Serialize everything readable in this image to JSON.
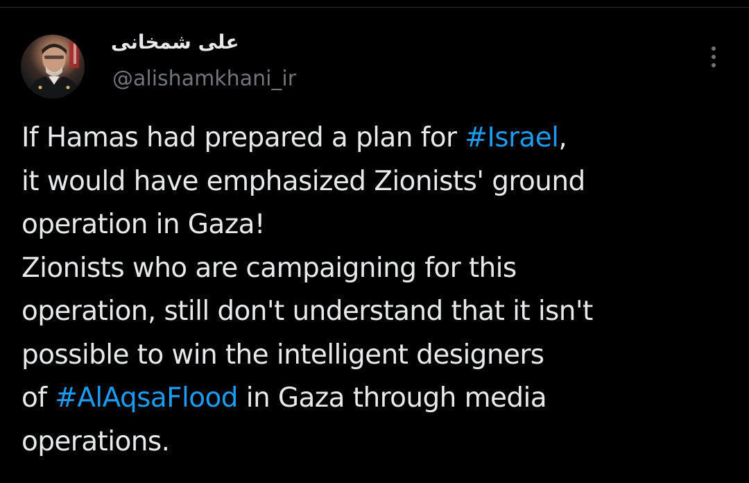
{
  "tweet": {
    "author": {
      "display_name": "علی شمخانی",
      "handle": "@alishamkhani_ir",
      "avatar_icon": "profile-photo"
    },
    "more_icon": "more-vertical-icon",
    "lines": [
      [
        "If Hamas had prepared a plan for ",
        "#Israel",
        ","
      ],
      [
        "it would have emphasized Zionists' ground"
      ],
      [
        "operation in Gaza!"
      ],
      [
        "Zionists who are campaigning for this"
      ],
      [
        "operation, still don't understand that it isn't"
      ],
      [
        "possible to win the intelligent designers"
      ],
      [
        "of ",
        "#AlAqsaFlood",
        " in Gaza through media"
      ],
      [
        "operations."
      ]
    ]
  },
  "colors": {
    "background": "#000000",
    "text": "#e7e9ea",
    "secondary_text": "#71767b",
    "link": "#1d9bf0"
  }
}
